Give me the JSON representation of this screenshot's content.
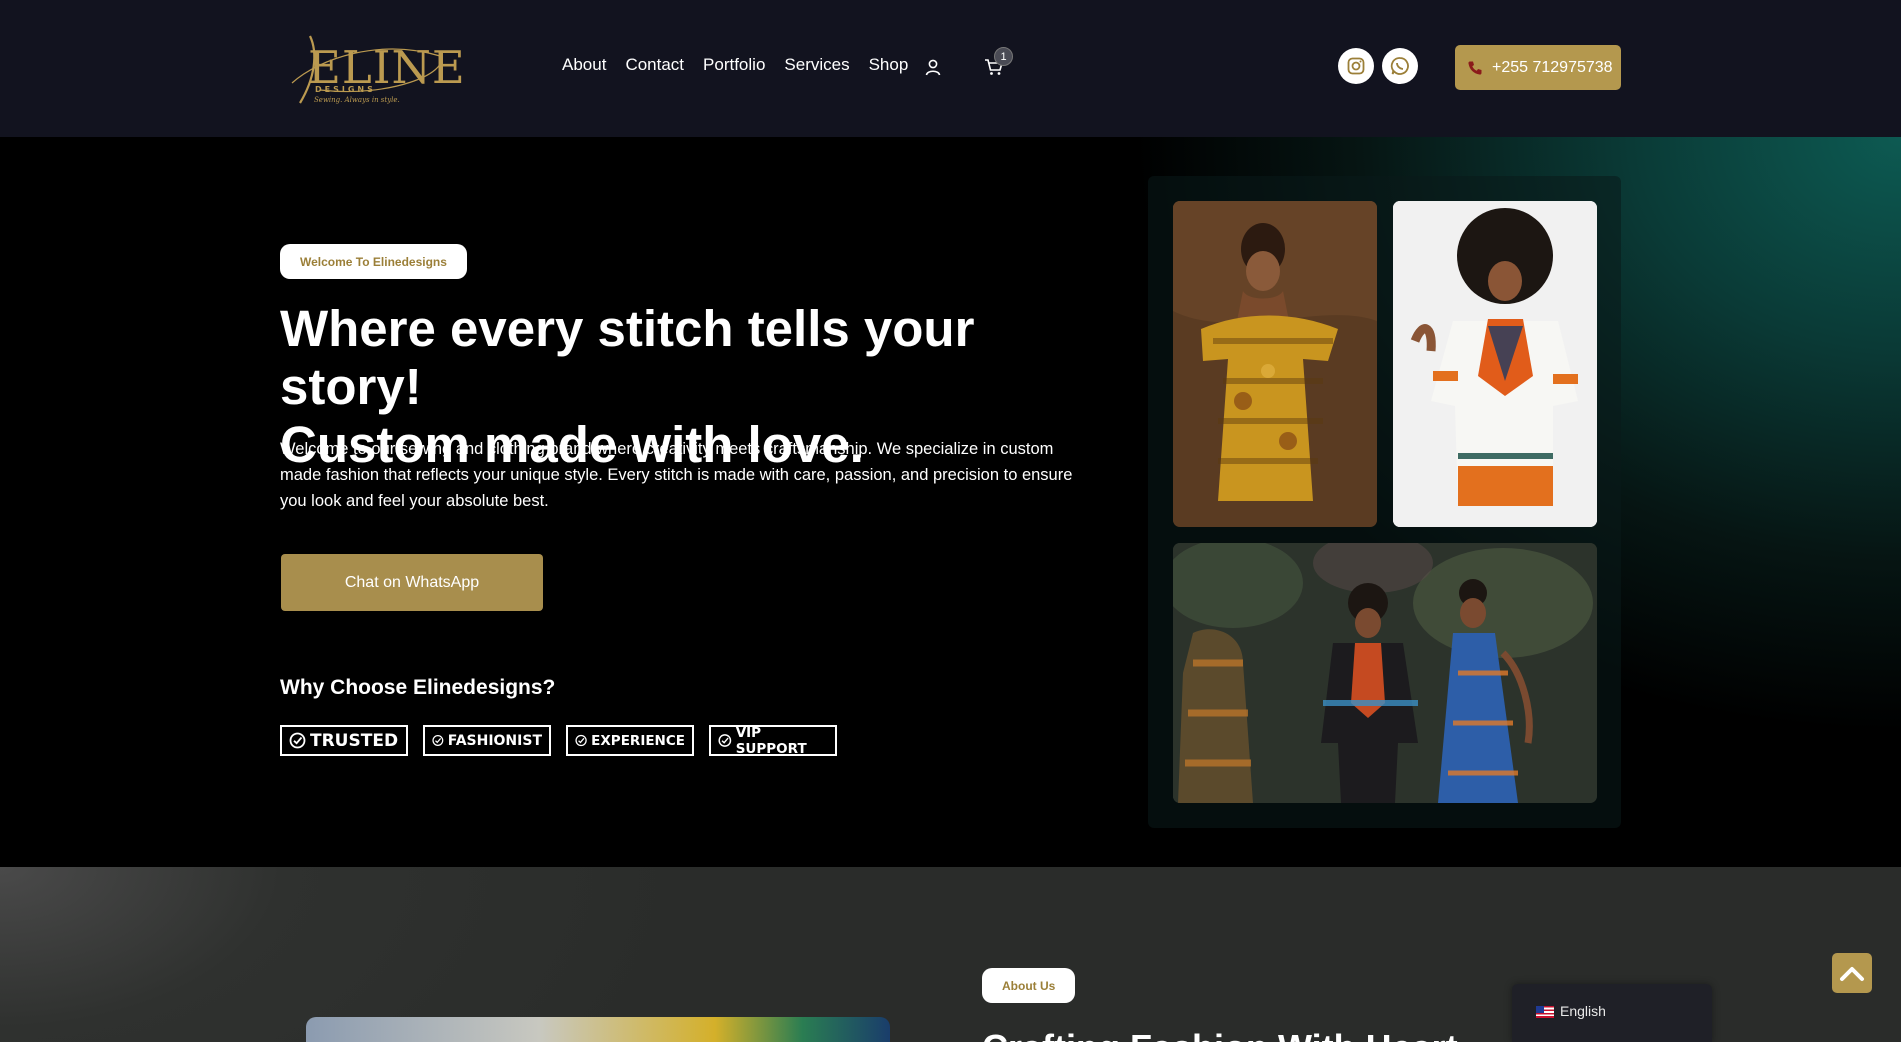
{
  "header": {
    "logo": {
      "name": "ELINE",
      "sub": "DESIGNS",
      "tagline": "Sewing. Always in style."
    },
    "nav": [
      {
        "label": "About"
      },
      {
        "label": "Contact"
      },
      {
        "label": "Portfolio"
      },
      {
        "label": "Services"
      },
      {
        "label": "Shop"
      }
    ],
    "cart_count": "1",
    "phone": "+255 712975738",
    "icons": [
      "user-icon",
      "cart-icon",
      "instagram-icon",
      "whatsapp-icon",
      "phone-icon"
    ]
  },
  "hero": {
    "pill": "Welcome To Elinedesigns",
    "title_line1": "Where every stitch tells your story!",
    "title_line2": "Custom made with love.",
    "text": "Welcome to our sewing and clothing brand where creativity meets craftsmanship. We specialize in custom made fashion that reflects your unique style. Every stitch is made with care, passion, and precision to ensure you look and feel your absolute best.",
    "cta": "Chat on WhatsApp",
    "why_title": "Why Choose Elinedesigns?",
    "badges": [
      "TRUSTED",
      "FASHIONIST",
      "EXPERIENCE",
      "VIP SUPPORT"
    ]
  },
  "about": {
    "pill": "About Us",
    "title": "Crafting Fashion With Heart"
  },
  "language": {
    "label": "English"
  },
  "colors": {
    "gold": "#b4984e",
    "header_bg": "#12131f",
    "teal": "#0d5a52"
  }
}
